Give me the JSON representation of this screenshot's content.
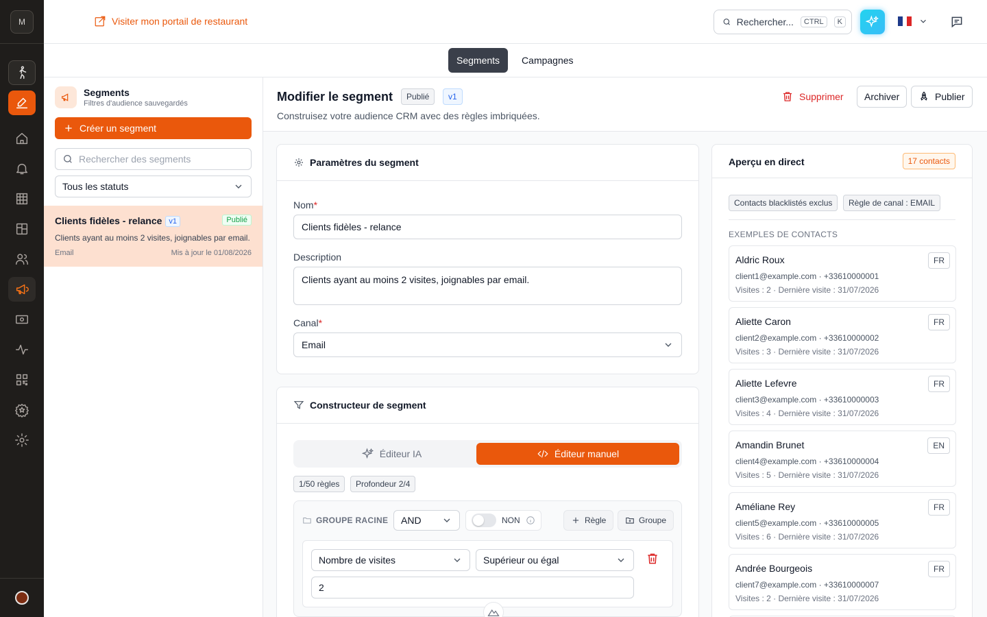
{
  "rail": {
    "logo_letter": "M",
    "icons": [
      "walking-person-icon",
      "edit-icon",
      "home-icon",
      "bell-icon",
      "grid-icon",
      "layout-icon",
      "users-icon",
      "megaphone-icon",
      "banknote-icon",
      "activity-icon",
      "qr-code-icon",
      "star-badge-icon",
      "gear-icon",
      "avatar-icon"
    ]
  },
  "topbar": {
    "portal_link": "Visiter mon portail de restaurant",
    "search_label": "Rechercher...",
    "kbd_ctrl": "CTRL",
    "kbd_k": "K",
    "language_flag": "fr"
  },
  "tabs": [
    {
      "label": "Segments",
      "active": true
    },
    {
      "label": "Campagnes",
      "active": false
    }
  ],
  "list_panel": {
    "title": "Segments",
    "subtitle": "Filtres d'audience sauvegardés",
    "create_button": "Créer un segment",
    "search_placeholder": "Rechercher des segments",
    "status_filter": "Tous les statuts",
    "items": [
      {
        "title": "Clients fidèles - relance",
        "version": "v1",
        "status": "Publié",
        "description": "Clients ayant au moins 2 visites, joignables par email.",
        "channel": "Email",
        "updated": "Mis à jour le 01/08/2026"
      }
    ]
  },
  "editor": {
    "title": "Modifier le segment",
    "status_badge": "Publié",
    "version_badge": "v1",
    "description": "Construisez votre audience CRM avec des règles imbriquées.",
    "delete_button": "Supprimer",
    "archive_button": "Archiver",
    "publish_button": "Publier",
    "params": {
      "heading": "Paramètres du segment",
      "name_label": "Nom",
      "name_value": "Clients fidèles - relance",
      "description_label": "Description",
      "description_value": "Clients ayant au moins 2 visites, joignables par email.",
      "channel_label": "Canal",
      "channel_value": "Email",
      "required_mark": "*"
    },
    "builder": {
      "heading": "Constructeur de segment",
      "ai_editor": "Éditeur IA",
      "manual_editor": "Éditeur manuel",
      "rules_count": "1/50 règles",
      "depth": "Profondeur 2/4",
      "root_group_label": "GROUPE RACINE",
      "operator": "AND",
      "negate_label": "NON",
      "add_rule": "Règle",
      "add_group": "Groupe",
      "rule": {
        "field": "Nombre de visites",
        "comparator": "Supérieur ou égal",
        "value": "2"
      }
    }
  },
  "preview": {
    "title": "Aperçu en direct",
    "count": "17 contacts",
    "chips": [
      "Contacts blacklistés exclus",
      "Règle de canal : EMAIL"
    ],
    "examples_label": "EXEMPLES DE CONTACTS",
    "contacts": [
      {
        "name": "Aldric Roux",
        "lang": "FR",
        "contact": "client1@example.com · +33610000001",
        "visits": "Visites : 2 · Dernière visite : 31/07/2026"
      },
      {
        "name": "Aliette Caron",
        "lang": "FR",
        "contact": "client2@example.com · +33610000002",
        "visits": "Visites : 3 · Dernière visite : 31/07/2026"
      },
      {
        "name": "Aliette Lefevre",
        "lang": "FR",
        "contact": "client3@example.com · +33610000003",
        "visits": "Visites : 4 · Dernière visite : 31/07/2026"
      },
      {
        "name": "Amandin Brunet",
        "lang": "EN",
        "contact": "client4@example.com · +33610000004",
        "visits": "Visites : 5 · Dernière visite : 31/07/2026"
      },
      {
        "name": "Améliane Rey",
        "lang": "FR",
        "contact": "client5@example.com · +33610000005",
        "visits": "Visites : 6 · Dernière visite : 31/07/2026"
      },
      {
        "name": "Andrée Bourgeois",
        "lang": "FR",
        "contact": "client7@example.com · +33610000007",
        "visits": "Visites : 2 · Dernière visite : 31/07/2026"
      }
    ]
  },
  "colors": {
    "accent": "#ea580c",
    "rail_bg": "#1f1d1b",
    "selected_item_bg": "#fde0d0",
    "danger": "#dc2626"
  }
}
